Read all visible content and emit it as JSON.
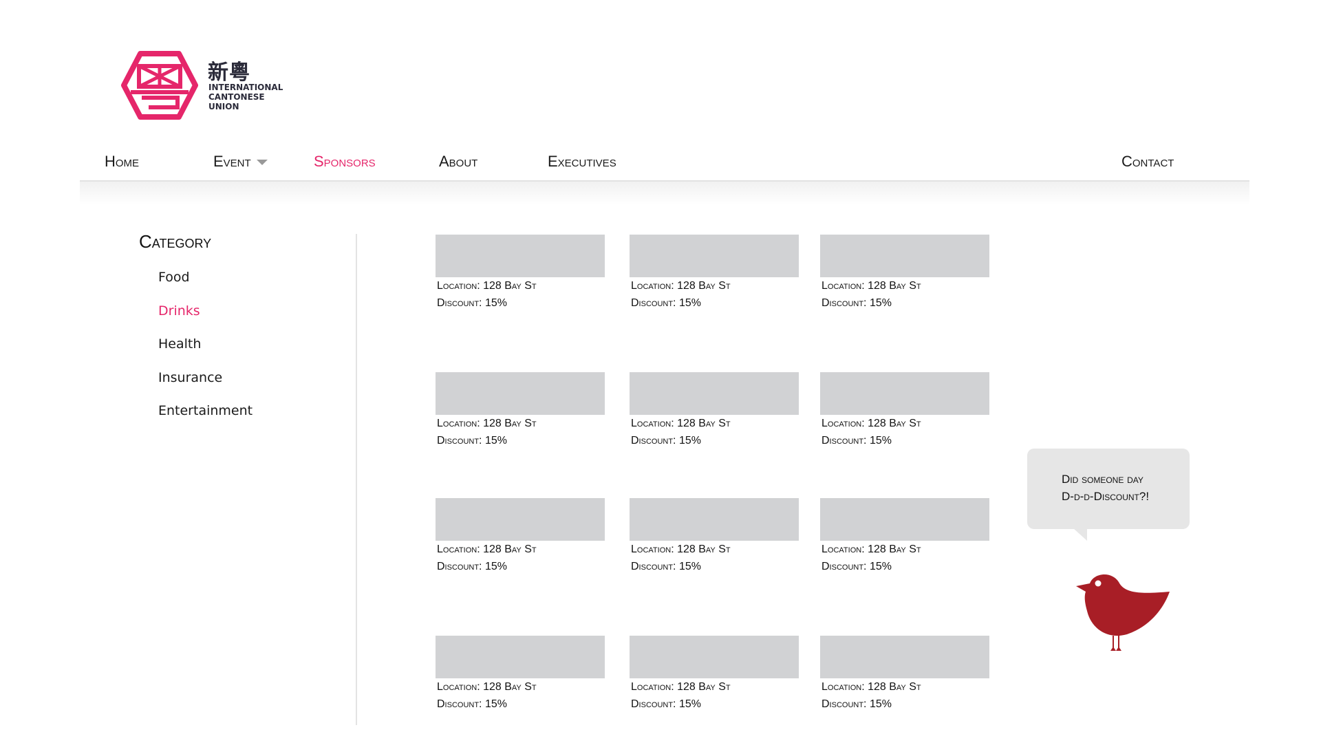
{
  "logo": {
    "chinese": "新粵",
    "english": [
      "INTERNATIONAL",
      "CANTONESE",
      "UNION"
    ],
    "color": "#e5266a"
  },
  "nav": {
    "home": "Home",
    "event": "Event",
    "sponsors": "Sponsors",
    "about": "About",
    "executives": "Executives",
    "contact": "Contact",
    "active": "sponsors"
  },
  "sidebar": {
    "title": "Category",
    "items": [
      "Food",
      "Drinks",
      "Health",
      "Insurance",
      "Entertainment"
    ],
    "active_item": "Drinks"
  },
  "sponsors": [
    {
      "location": "Location: 128 Bay St",
      "discount": "Discount: 15%"
    },
    {
      "location": "Location: 128 Bay St",
      "discount": "Discount: 15%"
    },
    {
      "location": "Location: 128 Bay St",
      "discount": "Discount: 15%"
    },
    {
      "location": "Location: 128 Bay St",
      "discount": "Discount: 15%"
    },
    {
      "location": "Location: 128 Bay St",
      "discount": "Discount: 15%"
    },
    {
      "location": "Location: 128 Bay St",
      "discount": "Discount: 15%"
    },
    {
      "location": "Location: 128 Bay St",
      "discount": "Discount: 15%"
    },
    {
      "location": "Location: 128 Bay St",
      "discount": "Discount: 15%"
    },
    {
      "location": "Location: 128 Bay St",
      "discount": "Discount: 15%"
    },
    {
      "location": "Location: 128 Bay St",
      "discount": "Discount: 15%"
    },
    {
      "location": "Location: 128 Bay St",
      "discount": "Discount: 15%"
    },
    {
      "location": "Location: 128 Bay St",
      "discount": "Discount: 15%"
    }
  ],
  "bubble": {
    "line1": "Did someone day",
    "line2": "D-d-d-Discount?!"
  },
  "colors": {
    "accent": "#e5266a",
    "bird": "#a81e26",
    "placeholder": "#d1d2d4",
    "bubble": "#e6e6e6"
  }
}
